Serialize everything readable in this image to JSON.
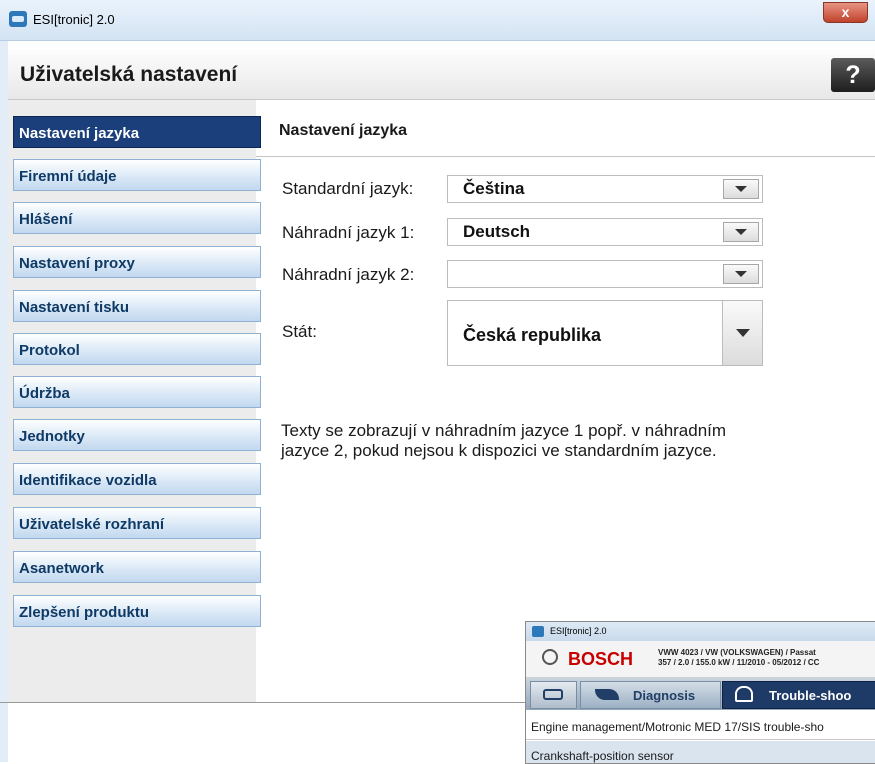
{
  "window": {
    "title": "ESI[tronic] 2.0",
    "close_label": "x"
  },
  "header": {
    "title": "Uživatelská nastavení",
    "help_label": "?"
  },
  "sidebar": {
    "items": [
      {
        "label": "Nastavení jazyka",
        "active": true
      },
      {
        "label": "Firemní údaje"
      },
      {
        "label": "Hlášení"
      },
      {
        "label": "Nastavení proxy"
      },
      {
        "label": "Nastavení tisku"
      },
      {
        "label": "Protokol"
      },
      {
        "label": "Údržba"
      },
      {
        "label": "Jednotky"
      },
      {
        "label": "Identifikace vozidla"
      },
      {
        "label": "Uživatelské rozhraní"
      },
      {
        "label": "Asanetwork"
      },
      {
        "label": "Zlepšení produktu"
      }
    ]
  },
  "main": {
    "section_title": "Nastavení jazyka",
    "fields": {
      "standard": {
        "label": "Standardní jazyk:",
        "value": "Čeština"
      },
      "alt1": {
        "label": "Náhradní jazyk 1:",
        "value": "Deutsch"
      },
      "alt2": {
        "label": "Náhradní jazyk 2:",
        "value": ""
      },
      "country": {
        "label": "Stát:",
        "value": "Česká republika"
      }
    },
    "info_text": "Texty se zobrazují v náhradním jazyce 1 popř. v náhradním jazyce 2, pokud nejsou k dispozici ve standardním jazyce."
  },
  "thumbnail": {
    "title": "ESI[tronic] 2.0",
    "brand": "BOSCH",
    "vehicle_line1": "VWW 4023 / VW (VOLKSWAGEN) / Passat",
    "vehicle_line2": "357 / 2.0 / 155.0 kW / 11/2010 - 05/2012 / CC",
    "tab_diagnosis": "Diagnosis",
    "tab_troubleshooting": "Trouble-shoo",
    "row1": "Engine management/Motronic MED 17/SIS trouble-sho",
    "row2": "Crankshaft-position sensor"
  },
  "colors": {
    "accent": "#1b3f7a",
    "nav_text": "#0f3a66",
    "bosch_red": "#c80000"
  }
}
